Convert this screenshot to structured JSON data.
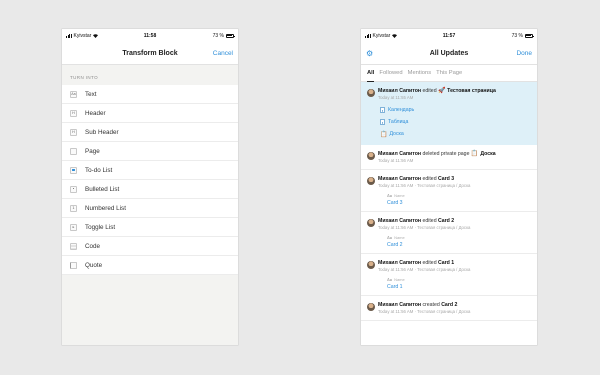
{
  "left_screen": {
    "status": {
      "carrier": "Kyivstar",
      "time": "11:58",
      "battery": "73 %"
    },
    "nav": {
      "title": "Transform Block",
      "cancel_label": "Cancel"
    },
    "section_label": "TURN INTO",
    "items": [
      {
        "label": "Text",
        "icon": "text-icon",
        "glyph": "Aa"
      },
      {
        "label": "Header",
        "icon": "header-icon",
        "glyph": "H"
      },
      {
        "label": "Sub Header",
        "icon": "subheader-icon",
        "glyph": "H"
      },
      {
        "label": "Page",
        "icon": "page-icon",
        "glyph": ""
      },
      {
        "label": "To-do List",
        "icon": "todo-icon",
        "glyph": ""
      },
      {
        "label": "Bulleted List",
        "icon": "bulleted-list-icon",
        "glyph": "•"
      },
      {
        "label": "Numbered List",
        "icon": "numbered-list-icon",
        "glyph": "1"
      },
      {
        "label": "Toggle List",
        "icon": "toggle-list-icon",
        "glyph": "▸"
      },
      {
        "label": "Code",
        "icon": "code-icon",
        "glyph": ""
      },
      {
        "label": "Quote",
        "icon": "quote-icon",
        "glyph": ""
      }
    ]
  },
  "right_screen": {
    "status": {
      "carrier": "Kyivstar",
      "time": "11:57",
      "battery": "73 %"
    },
    "nav": {
      "title": "All Updates",
      "done_label": "Done",
      "settings_icon": "gear-icon"
    },
    "tabs": [
      "All",
      "Followed",
      "Mentions",
      "This Page"
    ],
    "active_tab": "All",
    "entries": [
      {
        "user": "Михаил Сапитон",
        "action": " edited ",
        "target": "Тестовая страница",
        "meta": "Today at 11:55 AM",
        "subitems": [
          "Календарь",
          "Таблица",
          "Доска"
        ]
      },
      {
        "user": "Михаил Сапитон",
        "action": " deleted private page ",
        "target": "Доска",
        "meta": "Today at 11:56 AM"
      },
      {
        "user": "Михаил Сапитон",
        "action": " edited ",
        "target": "Card 3",
        "meta": "Today at 11:56 AM · Тестовая страница / Доска",
        "prop_name": "Name",
        "prop_value": "Card 3"
      },
      {
        "user": "Михаил Сапитон",
        "action": " edited ",
        "target": "Card 2",
        "meta": "Today at 11:56 AM · Тестовая страница / Доска",
        "prop_name": "Name",
        "prop_value": "Card 2"
      },
      {
        "user": "Михаил Сапитон",
        "action": " edited ",
        "target": "Card 1",
        "meta": "Today at 11:56 AM · Тестовая страница / Доска",
        "prop_name": "Name",
        "prop_value": "Card 1"
      },
      {
        "user": "Михаил Сапитон",
        "action": " created ",
        "target": "Card 2",
        "meta": "Today at 11:56 AM · Тестовая страница / Доска"
      }
    ]
  }
}
